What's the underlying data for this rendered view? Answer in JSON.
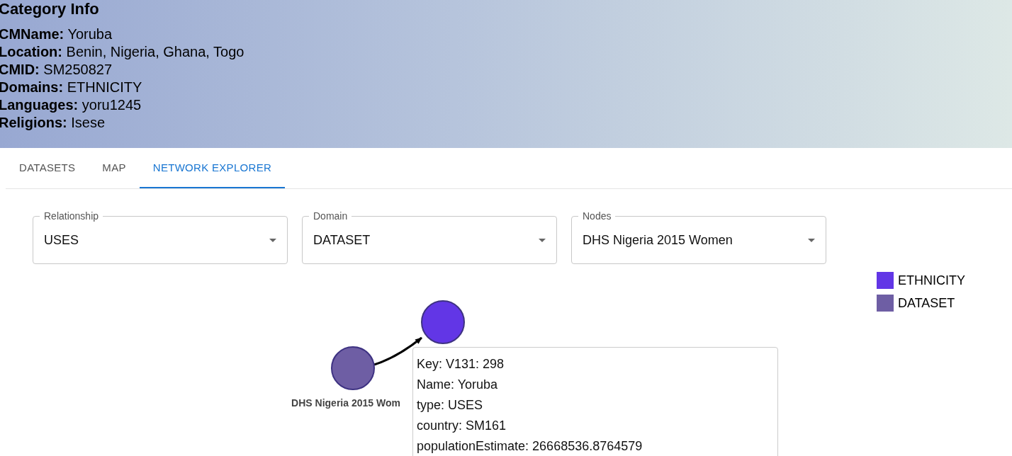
{
  "header": {
    "title": "Category Info",
    "fields": [
      {
        "label": "CMName:",
        "value": "Yoruba"
      },
      {
        "label": "Location:",
        "value": "Benin, Nigeria, Ghana, Togo"
      },
      {
        "label": "CMID:",
        "value": "SM250827"
      },
      {
        "label": "Domains:",
        "value": "ETHNICITY"
      },
      {
        "label": "Languages:",
        "value": "yoru1245"
      },
      {
        "label": "Religions:",
        "value": "Isese"
      }
    ]
  },
  "tabs": [
    {
      "label": "DATASETS",
      "selected": false
    },
    {
      "label": "MAP",
      "selected": false
    },
    {
      "label": "NETWORK EXPLORER",
      "selected": true
    }
  ],
  "filters": [
    {
      "label": "Relationship",
      "value": "USES"
    },
    {
      "label": "Domain",
      "value": "DATASET"
    },
    {
      "label": "Nodes",
      "value": "DHS Nigeria 2015 Women"
    }
  ],
  "legend": [
    {
      "label": "ETHNICITY",
      "color": "#6236e6"
    },
    {
      "label": "DATASET",
      "color": "#6e5ea4"
    }
  ],
  "graph": {
    "nodes": [
      {
        "color": "#6e5ea4",
        "label": "DHS Nigeria 2015 Wom"
      },
      {
        "color": "#6236e6"
      }
    ],
    "tooltip": [
      "Key: V131: 298",
      "Name: Yoruba",
      "type: USES",
      "country: SM161",
      "populationEstimate: 26668536.8764579"
    ]
  }
}
